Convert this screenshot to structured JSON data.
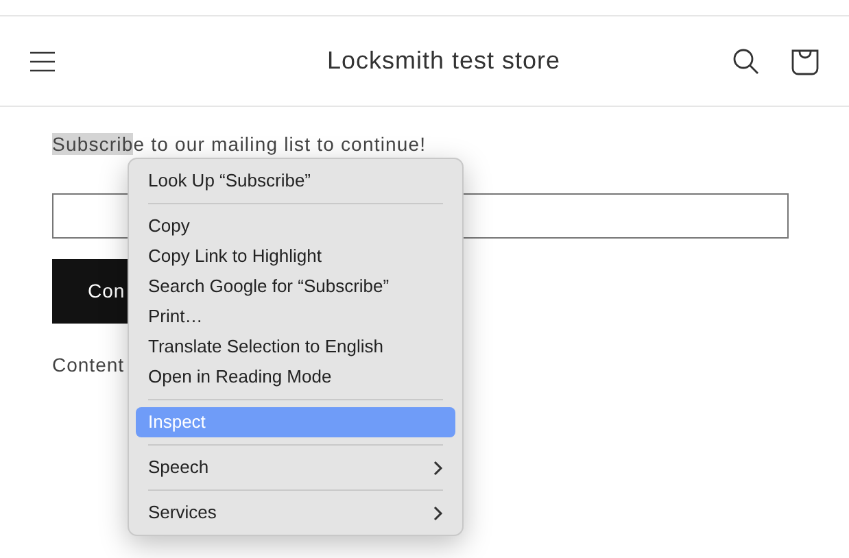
{
  "header": {
    "title": "Locksmith test store"
  },
  "page": {
    "prompt": {
      "selected_part": "Subscrib",
      "rest": "e to our mailing list to continue!"
    },
    "button": {
      "label": "Con"
    },
    "footer_text": "Content"
  },
  "context_menu": {
    "items": [
      {
        "kind": "item",
        "label": "Look Up “Subscribe”",
        "selected": false,
        "submenu": false
      },
      {
        "kind": "separator"
      },
      {
        "kind": "item",
        "label": "Copy",
        "selected": false,
        "submenu": false
      },
      {
        "kind": "item",
        "label": "Copy Link to Highlight",
        "selected": false,
        "submenu": false
      },
      {
        "kind": "item",
        "label": "Search Google for “Subscribe”",
        "selected": false,
        "submenu": false
      },
      {
        "kind": "item",
        "label": "Print…",
        "selected": false,
        "submenu": false
      },
      {
        "kind": "item",
        "label": "Translate Selection to English",
        "selected": false,
        "submenu": false
      },
      {
        "kind": "item",
        "label": "Open in Reading Mode",
        "selected": false,
        "submenu": false
      },
      {
        "kind": "separator"
      },
      {
        "kind": "item",
        "label": "Inspect",
        "selected": true,
        "submenu": false
      },
      {
        "kind": "separator"
      },
      {
        "kind": "item",
        "label": "Speech",
        "selected": false,
        "submenu": true
      },
      {
        "kind": "separator"
      },
      {
        "kind": "item",
        "label": "Services",
        "selected": false,
        "submenu": true
      }
    ]
  }
}
